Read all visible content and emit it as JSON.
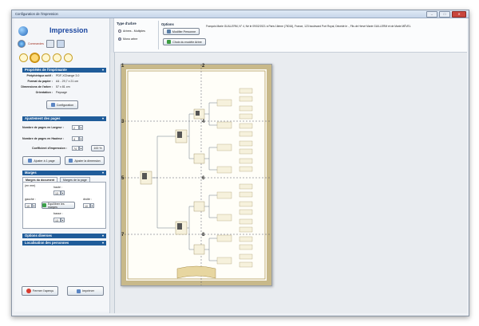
{
  "window": {
    "title": "Configuration de l'impression"
  },
  "sidebar": {
    "title": "Impression",
    "commands_label": "Commandes",
    "printer": {
      "header": "Propriétés de l'imprimante",
      "rows": [
        {
          "k": "Périphérique actif :",
          "v": "PDF-XChange 3.0"
        },
        {
          "k": "Format du papier :",
          "v": "A4 - 29,7 x 21 cm"
        },
        {
          "k": "Dimensions de l'arbre :",
          "v": "57 x 81 cm"
        },
        {
          "k": "Orientation :",
          "v": "Paysage"
        }
      ],
      "config_button": "Configuration"
    },
    "pages": {
      "header": "Ajustement des pages",
      "width_label": "Nombre de pages en Largeur :",
      "width_value": "2",
      "height_label": "Nombre de pages en Hauteur :",
      "height_value": "4",
      "coef_label": "Coefficient d'impression :",
      "coef_value": "74",
      "percent_button": "100 %",
      "fit_one_button": "Ajuster à 1 page",
      "fit_dim_button": "Ajuster la dimension"
    },
    "margins": {
      "header": "Marges",
      "tab_doc": "Marges du document",
      "tab_page": "Marges de la page",
      "unit": "(en mm)",
      "top_label": "haute :",
      "top_value": "13",
      "left_label": "gauche :",
      "left_value": "10",
      "right_label": "droite :",
      "right_value": "10",
      "bottom_label": "basse :",
      "bottom_value": "13",
      "balance_button": "Equilibrer les marges"
    },
    "misc_header": "Options diverses",
    "locate_header": "Localisation des personnes",
    "close_button": "Fermer l'aperçu",
    "print_button": "Imprimer"
  },
  "toolbar": {
    "tree_type_title": "Type d'arbre",
    "tree_multi": "Arbres - Multiples",
    "tree_mono": "Mono arbre",
    "options_title": "Options",
    "modify_person": "Modifier Personne",
    "choose_model": "Choix du modèle Arbre",
    "person_info": "François Marie GUILLERM, N° 4, Né le 09/02/1921 à Paris 16ème (75016), France, 123 boulevard Port Royal, Décédé le ., Fils de Hervé Marie GUILLERM et de Marie MÉVEL"
  },
  "preview": {
    "page_numbers": [
      "1",
      "2",
      "3",
      "4",
      "5",
      "6",
      "7",
      "8"
    ]
  },
  "colors": {
    "accent": "#1f5c9a",
    "title": "#1a46a0",
    "paper_border": "#c8b98a"
  }
}
